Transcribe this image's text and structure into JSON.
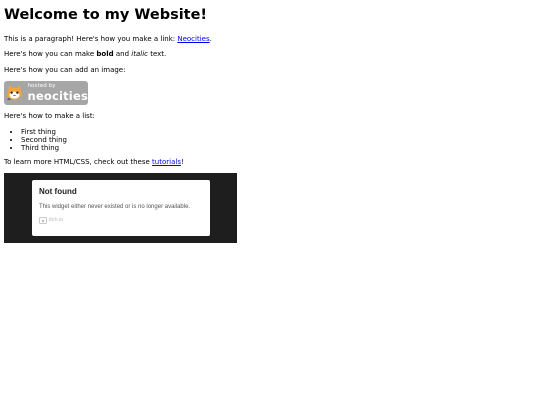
{
  "page": {
    "heading": "Welcome to my Website!",
    "p1_prefix": "This is a paragraph! Here's how you make a link: ",
    "p1_link": "Neocities",
    "p1_suffix": ".",
    "p2_prefix": "Here's how you can make ",
    "p2_bold": "bold",
    "p2_mid": " and ",
    "p2_italic": "italic",
    "p2_suffix": " text.",
    "p3": "Here's how you can add an image:",
    "badge": {
      "small_text": "hosted by",
      "big_text": "neocities"
    },
    "p4": "Here's how to make a list:",
    "list": [
      "First thing",
      "Second thing",
      "Third thing"
    ],
    "p5_prefix": "To learn more HTML/CSS, check out these ",
    "p5_link": "tutorials",
    "p5_suffix": "!"
  },
  "widget": {
    "title": "Not found",
    "message": "This widget either never existed or is no longer available.",
    "brand": "itch.io"
  },
  "colors": {
    "link": "#0000ee",
    "badge_bg": "#a6a6a6",
    "widget_bg": "#1e1e1e"
  }
}
